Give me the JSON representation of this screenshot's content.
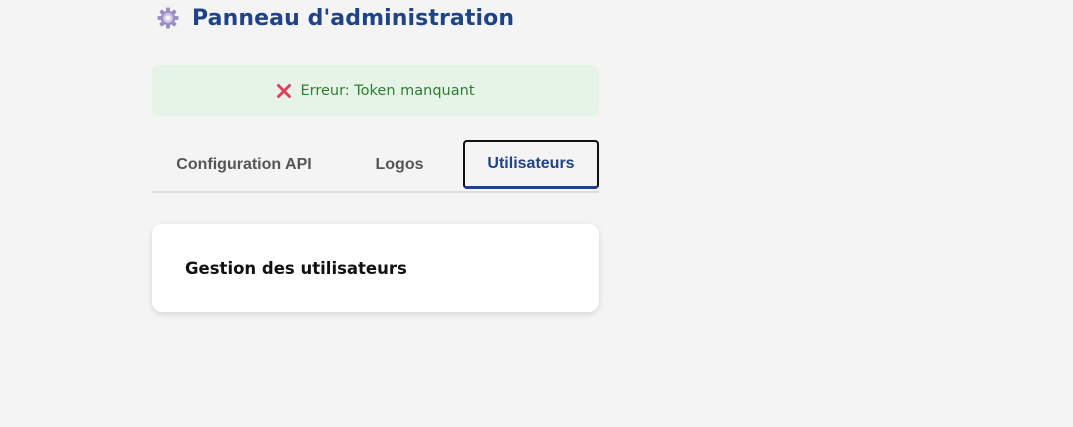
{
  "header": {
    "icon": "gear-icon",
    "title": "Panneau d'administration"
  },
  "alert": {
    "icon": "cross-mark-icon",
    "text": "Erreur: Token manquant",
    "icon_color": "#e0405e",
    "text_color": "#2e7d32",
    "background": "#e6f4e8"
  },
  "tabs": [
    {
      "label": "Configuration API",
      "active": false
    },
    {
      "label": "Logos",
      "active": false
    },
    {
      "label": "Utilisateurs",
      "active": true
    }
  ],
  "content": {
    "title": "Gestion des utilisateurs"
  },
  "colors": {
    "accent": "#1e4387",
    "background": "#f4f4f4"
  }
}
